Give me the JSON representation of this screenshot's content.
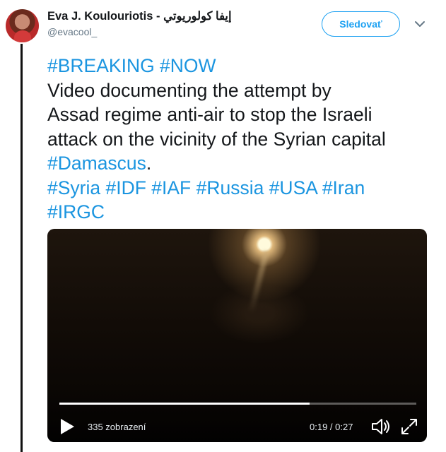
{
  "author": {
    "name": "Eva J. Koulouriotis - إيفا كولوريوتي",
    "handle": "@evacool_"
  },
  "follow_label": "Sledovať",
  "tweet": {
    "lines": [
      [
        {
          "t": "#BREAKING #NOW",
          "tag": true
        }
      ],
      [
        {
          "t": "Video documenting the attempt by",
          "tag": false
        }
      ],
      [
        {
          "t": "Assad regime anti-air to stop the Israeli",
          "tag": false
        }
      ],
      [
        {
          "t": "attack on the vicinity of the Syrian capital",
          "tag": false
        }
      ],
      [
        {
          "t": "#Damascus",
          "tag": true
        },
        {
          "t": ".",
          "tag": false
        }
      ],
      [
        {
          "t": "#Syria #IDF #IAF #Russia #USA #Iran",
          "tag": true
        }
      ],
      [
        {
          "t": "#IRGC",
          "tag": true
        }
      ]
    ]
  },
  "video": {
    "views": "335 zobrazení",
    "time": "0:19 / 0:27",
    "progress": 0.7
  },
  "colors": {
    "link": "#1b95e0",
    "follow": "#1da1f2"
  },
  "icons": [
    "caret-down-icon",
    "play-icon",
    "volume-icon",
    "fullscreen-icon"
  ]
}
